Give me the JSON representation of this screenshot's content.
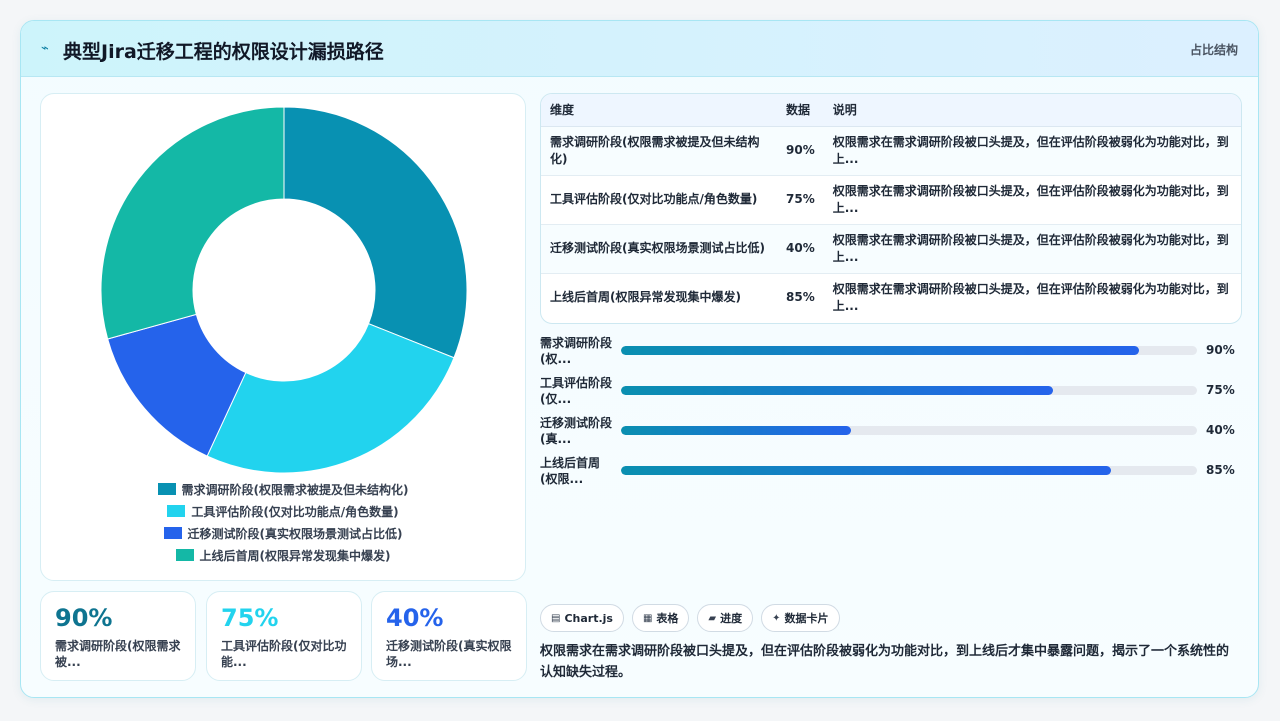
{
  "header": {
    "title": "典型Jira迁移工程的权限设计漏损路径",
    "tag": "占比结构"
  },
  "chart_data": {
    "type": "pie",
    "categories": [
      "需求调研阶段(权限需求被提及但未结构化)",
      "工具评估阶段(仅对比功能点/角色数量)",
      "迁移测试阶段(真实权限场景测试占比低)",
      "上线后首周(权限异常发现集中爆发)"
    ],
    "values": [
      90,
      75,
      40,
      85
    ],
    "colors": [
      "#0891b2",
      "#22d3ee",
      "#2563eb",
      "#14b8a6"
    ]
  },
  "kpis": [
    {
      "value": "90%",
      "label1": "需求调研阶段(权限需求",
      "label2": "被...",
      "color": "#0e7490"
    },
    {
      "value": "75%",
      "label1": "工具评估阶段(仅对比功",
      "label2": "能...",
      "color": "#22d3ee"
    },
    {
      "value": "40%",
      "label1": "迁移测试阶段(真实权限",
      "label2": "场...",
      "color": "#2563eb"
    }
  ],
  "table": {
    "headers": [
      "维度",
      "数据",
      "说明"
    ],
    "rows": [
      {
        "dim": "需求调研阶段(权限需求被提及但未结构化)",
        "val": "90%",
        "desc": "权限需求在需求调研阶段被口头提及，但在评估阶段被弱化为功能对比，到上..."
      },
      {
        "dim": "工具评估阶段(仅对比功能点/角色数量)",
        "val": "75%",
        "desc": "权限需求在需求调研阶段被口头提及，但在评估阶段被弱化为功能对比，到上..."
      },
      {
        "dim": "迁移测试阶段(真实权限场景测试占比低)",
        "val": "40%",
        "desc": "权限需求在需求调研阶段被口头提及，但在评估阶段被弱化为功能对比，到上..."
      },
      {
        "dim": "上线后首周(权限异常发现集中爆发)",
        "val": "85%",
        "desc": "权限需求在需求调研阶段被口头提及，但在评估阶段被弱化为功能对比，到上..."
      }
    ]
  },
  "bars": [
    {
      "label1": "需求调研阶段",
      "label2": "(权...",
      "value": 90,
      "text": "90%"
    },
    {
      "label1": "工具评估阶段",
      "label2": "(仅...",
      "value": 75,
      "text": "75%"
    },
    {
      "label1": "迁移测试阶段",
      "label2": "(真...",
      "value": 40,
      "text": "40%"
    },
    {
      "label1": "上线后首周",
      "label2": "(权限...",
      "value": 85,
      "text": "85%"
    }
  ],
  "chips": [
    {
      "icon": "▤",
      "label": "Chart.js"
    },
    {
      "icon": "▦",
      "label": "表格"
    },
    {
      "icon": "▰",
      "label": "进度"
    },
    {
      "icon": "✦",
      "label": "数据卡片"
    }
  ],
  "summary": "权限需求在需求调研阶段被口头提及，但在评估阶段被弱化为功能对比，到上线后才集中暴露问题，揭示了一个系统性的认知缺失过程。"
}
